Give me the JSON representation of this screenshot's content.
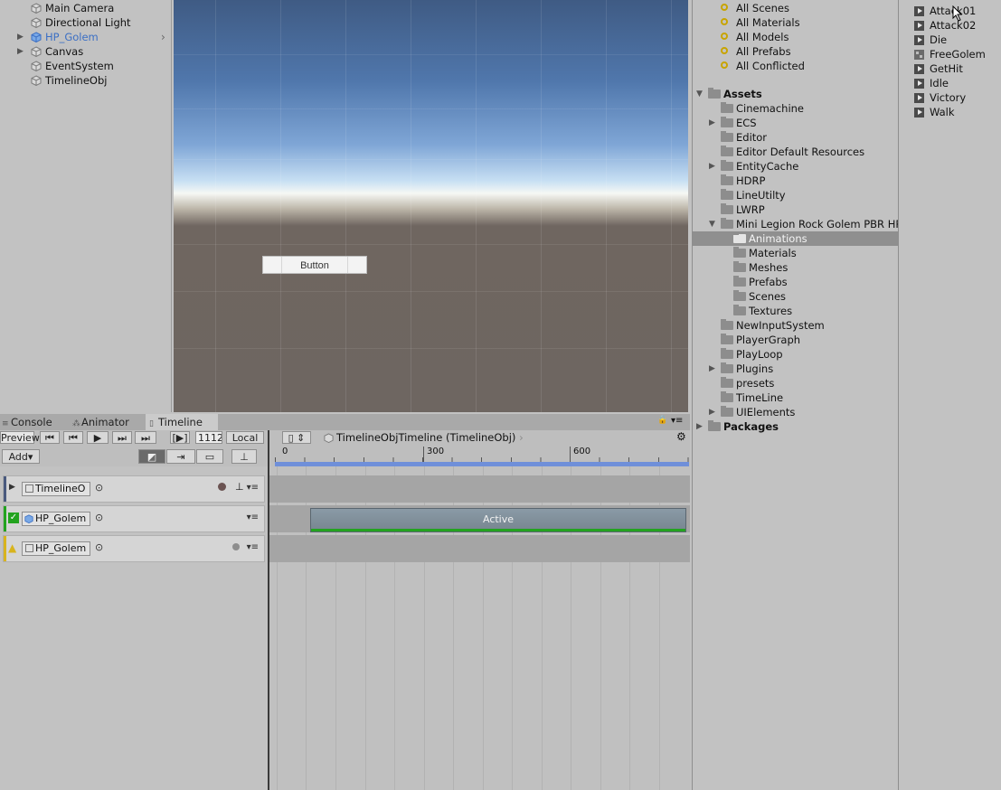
{
  "hierarchy": {
    "items": [
      {
        "label": "Main Camera",
        "arrow": ""
      },
      {
        "label": "Directional Light",
        "arrow": ""
      },
      {
        "label": "HP_Golem",
        "arrow": "▶"
      },
      {
        "label": "Canvas",
        "arrow": "▶"
      },
      {
        "label": "EventSystem",
        "arrow": ""
      },
      {
        "label": "TimelineObj",
        "arrow": ""
      }
    ],
    "chevron": "›"
  },
  "scene": {
    "button_label": "Button"
  },
  "tabs": [
    {
      "label": "Console",
      "icon": "≡"
    },
    {
      "label": "Animator",
      "icon": "⁂"
    },
    {
      "label": "Timeline",
      "icon": "▯"
    }
  ],
  "lock_icon": "🔒",
  "tab_menu_icon": "▾≡",
  "timeline": {
    "preview_label": "Preview",
    "frame_value": "1112",
    "local_label": "Local",
    "add_label": "Add▾",
    "bracket_label": "[▶]",
    "asset_label": "TimelineObjTimeline (TimelineObj)",
    "ruler_ticks": [
      "0",
      "300",
      "600"
    ],
    "tracks": [
      {
        "name": "TimelineO",
        "color": "#4a5a7e"
      },
      {
        "name": "HP_Golem",
        "color": "#23a31f"
      },
      {
        "name": "HP_Golem",
        "color": "#d8b41e"
      }
    ],
    "target_icon": "⊙",
    "menu_icon": "▾≡",
    "clip_label": "Active"
  },
  "project": {
    "favorites": [
      "All Scenes",
      "All Materials",
      "All Models",
      "All Prefabs",
      "All Conflicted"
    ],
    "assets_root": "Assets",
    "assets": [
      {
        "label": "Cinemachine",
        "arrow": ""
      },
      {
        "label": "ECS",
        "arrow": "▶"
      },
      {
        "label": "Editor",
        "arrow": ""
      },
      {
        "label": "Editor Default Resources",
        "arrow": ""
      },
      {
        "label": "EntityCache",
        "arrow": "▶"
      },
      {
        "label": "HDRP",
        "arrow": ""
      },
      {
        "label": "LineUtilty",
        "arrow": ""
      },
      {
        "label": "LWRP",
        "arrow": ""
      },
      {
        "label": "Mini Legion Rock Golem PBR HP",
        "arrow": "▼"
      }
    ],
    "golem_children": [
      "Animations",
      "Materials",
      "Meshes",
      "Prefabs",
      "Scenes",
      "Textures"
    ],
    "assets_after": [
      {
        "label": "NewInputSystem",
        "arrow": ""
      },
      {
        "label": "PlayerGraph",
        "arrow": ""
      },
      {
        "label": "PlayLoop",
        "arrow": ""
      },
      {
        "label": "Plugins",
        "arrow": "▶"
      },
      {
        "label": "presets",
        "arrow": ""
      },
      {
        "label": "TimeLine",
        "arrow": ""
      },
      {
        "label": "UIElements",
        "arrow": "▶"
      }
    ],
    "packages_root": "Packages"
  },
  "animations": [
    {
      "label": "Attack01",
      "kind": "clip"
    },
    {
      "label": "Attack02",
      "kind": "clip"
    },
    {
      "label": "Die",
      "kind": "clip"
    },
    {
      "label": "FreeGolem",
      "kind": "prefab"
    },
    {
      "label": "GetHit",
      "kind": "clip"
    },
    {
      "label": "Idle",
      "kind": "clip"
    },
    {
      "label": "Victory",
      "kind": "clip"
    },
    {
      "label": "Walk",
      "kind": "clip"
    }
  ]
}
